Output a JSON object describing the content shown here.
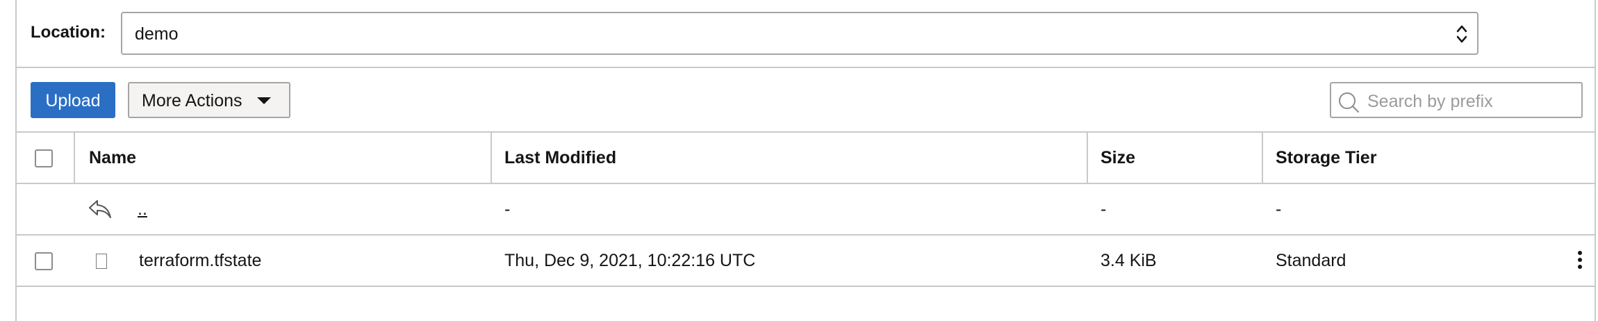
{
  "location": {
    "label": "Location:",
    "value": "demo"
  },
  "toolbar": {
    "upload_label": "Upload",
    "more_actions_label": "More Actions",
    "search_placeholder": "Search by prefix"
  },
  "table": {
    "headers": {
      "name": "Name",
      "last_modified": "Last Modified",
      "size": "Size",
      "storage_tier": "Storage Tier"
    },
    "parent_row": {
      "name": "..",
      "last_modified": "-",
      "size": "-",
      "storage_tier": "-"
    },
    "rows": [
      {
        "name": "terraform.tfstate",
        "last_modified": "Thu, Dec 9, 2021, 10:22:16 UTC",
        "size": "3.4 KiB",
        "storage_tier": "Standard"
      }
    ]
  },
  "colors": {
    "primary_button": "#2b6fc4",
    "border": "#c9c9c9",
    "text": "#161513"
  },
  "icons": {
    "parent": "reply-arrow-icon",
    "file": "file-icon",
    "search": "search-icon",
    "row_actions": "kebab-menu-icon",
    "select": "chevron-up-down-icon",
    "dropdown": "caret-down-icon"
  }
}
